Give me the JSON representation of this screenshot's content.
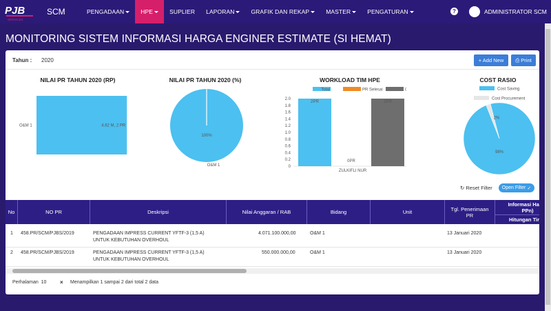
{
  "navbar": {
    "brand": "SCM",
    "logo_text": "PJB SERVICES",
    "menu": [
      {
        "label": "PENGADAAN",
        "caret": true,
        "active": false
      },
      {
        "label": "HPE",
        "caret": true,
        "active": true
      },
      {
        "label": "SUPLIER",
        "caret": false,
        "active": false
      },
      {
        "label": "LAPORAN",
        "caret": true,
        "active": false
      },
      {
        "label": "GRAFIK DAN REKAP",
        "caret": true,
        "active": false
      },
      {
        "label": "MASTER",
        "caret": true,
        "active": false
      },
      {
        "label": "PENGATURAN",
        "caret": true,
        "active": false
      }
    ],
    "help": "?",
    "user": "ADMINISTRATOR SCM"
  },
  "page_title": "MONITORING SISTEM INFORMASI HARGA ENGINER ESTIMATE (SI HEMAT)",
  "filter": {
    "tahun_label": "Tahun :",
    "tahun_value": "2020"
  },
  "buttons": {
    "add_new": "+ Add New",
    "print": "Print",
    "reset_filter": "Reset Filter",
    "open_filter": "Open Filter"
  },
  "chart_data": [
    {
      "type": "bar",
      "title": "NILAI PR TAHUN 2020 (RP)",
      "orientation": "horizontal",
      "categories": [
        "O&M 1"
      ],
      "values": [
        4.62
      ],
      "data_labels": [
        "4.62 M, 2 PR"
      ],
      "xticks": [
        "0 M",
        "1 M",
        "2 M",
        "3 M",
        "4 M",
        "5 M"
      ],
      "xlim": [
        0,
        5
      ],
      "color": "#4cc0f0"
    },
    {
      "type": "pie",
      "title": "NILAI PR TAHUN 2020 (%)",
      "labels": [
        "O&M 1"
      ],
      "values": [
        100
      ],
      "data_labels": [
        "100%"
      ],
      "colors": [
        "#4cc0f0"
      ]
    },
    {
      "type": "bar",
      "title": "WORKLOAD TIM HPE",
      "categories": [
        "ZULKIFLI NUR"
      ],
      "series": [
        {
          "name": "Total",
          "values": [
            2
          ],
          "color": "#4cc0f0",
          "label": "2PR"
        },
        {
          "name": "PR Selesai",
          "values": [
            0
          ],
          "color": "#f08a24",
          "label": "0PR"
        },
        {
          "name": "GAP PR",
          "values": [
            2
          ],
          "color": "#6e6e6e",
          "label": "2PR"
        }
      ],
      "yticks": [
        "0",
        "0.2",
        "0.4",
        "0.6",
        "0.8",
        "1.0",
        "1.2",
        "1.4",
        "1.6",
        "1.8",
        "2.0"
      ],
      "ylim": [
        0,
        2
      ],
      "legend": "top"
    },
    {
      "type": "pie",
      "title": "COST RASIO",
      "labels": [
        "Cost Saving",
        "Cost Procurement"
      ],
      "values": [
        98,
        2
      ],
      "data_labels": [
        "98%",
        "2%"
      ],
      "colors": [
        "#4cc0f0",
        "#e6e6e6"
      ],
      "legend": "top"
    }
  ],
  "table": {
    "headers": [
      "No",
      "NO PR",
      "Deskripsi",
      "Nilai Anggaran / RAB",
      "Bidang",
      "Unit",
      "Tgl. Penerimaan PR",
      "Informasi Harga PPn)",
      "Hitungan Tim"
    ],
    "rows": [
      {
        "no": "1",
        "no_pr": "458.PR/SCM/PJBS/2019",
        "desc1": "PENGADAAN IMPRESS CURRENT YFTF-3 (1,5 A)",
        "desc2": "UNTUK KEBUTUHAN OVERHOUL",
        "nilai": "4.071.100.000,00",
        "bidang": "O&M 1",
        "unit": "",
        "tgl": "13 Januari 2020"
      },
      {
        "no": "2",
        "no_pr": "458.PR/SCM/PJBS/2019",
        "desc1": "PENGADAAN IMPRESS CURRENT YFTF-3 (1,5 A)",
        "desc2": "UNTUK KEBUTUHAN OVERHOUL",
        "nilai": "550.000.000,00",
        "bidang": "O&M 1",
        "unit": "",
        "tgl": "13 Januari 2020"
      }
    ]
  },
  "footer": {
    "perhalaman_label": "Perhalaman",
    "perhalaman_value": "10",
    "clear": "×",
    "info": "Menampilkan 1 sampai 2 dari total 2 data"
  }
}
